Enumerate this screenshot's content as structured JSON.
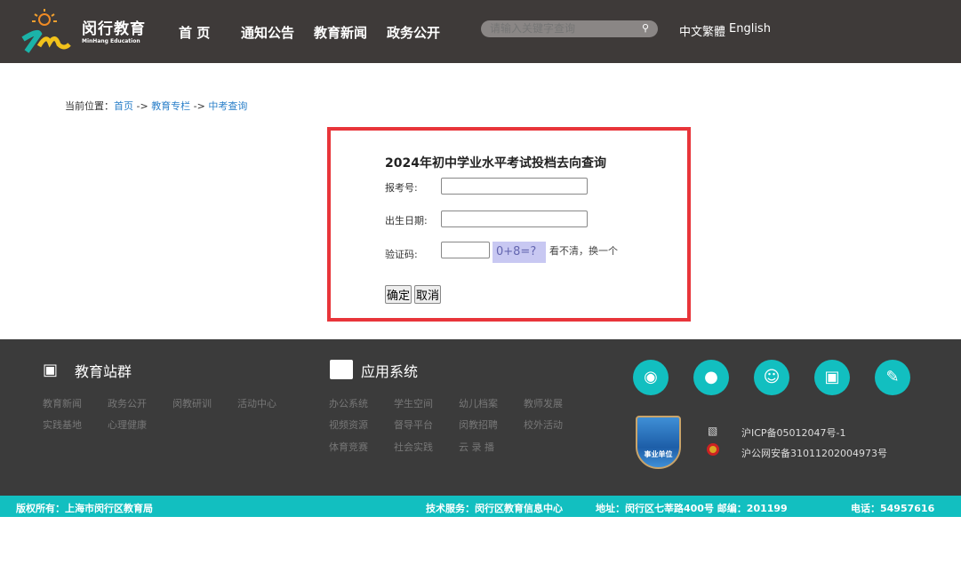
{
  "header": {
    "brand_cn": "闵行教育",
    "brand_en": "MinHang Education",
    "nav": [
      "首 页",
      "通知公告",
      "教育新闻",
      "政务公开"
    ],
    "search_placeholder": "请输入关键字查询",
    "search_icon": "search-icon",
    "lang_cn": "中文繁體",
    "lang_en": "English"
  },
  "breadcrumb": {
    "prefix": "当前位置：",
    "items": [
      "首页",
      "教育专栏",
      "中考查询"
    ],
    "sep": " -> "
  },
  "form": {
    "title": "2024年初中学业水平考试投档去向查询",
    "exam_no_label": "报考号:",
    "birth_label": "出生日期:",
    "captcha_label": "验证码:",
    "captcha_text": "0+8=?",
    "refresh_label": "看不清，换一个",
    "submit": "确定",
    "cancel": "取消",
    "exam_no": "",
    "birth": "",
    "captcha": ""
  },
  "footer": {
    "group1": {
      "title": "教育站群",
      "links": [
        "教育新闻",
        "政务公开",
        "闵教研训",
        "活动中心",
        "实践基地",
        "心理健康"
      ]
    },
    "group2": {
      "title": "应用系统",
      "links": [
        "办公系统",
        "学生空间",
        "幼儿档案",
        "教师发展",
        "视频资源",
        "督导平台",
        "闵教招聘",
        "校外活动",
        "体育竞赛",
        "社会实践",
        "云 录 播"
      ]
    },
    "social_icons": [
      "weibo-icon",
      "wechat-icon",
      "graduate-icon",
      "app-icon",
      "pencil-ruler-icon"
    ],
    "badge": "事业单位",
    "icp": "沪ICP备05012047号-1",
    "police": "沪公网安备31011202004973号"
  },
  "bottom": {
    "copyright": "版权所有：上海市闵行区教育局",
    "tech": "技术服务：闵行区教育信息中心",
    "address": "地址：闵行区七莘路400号 邮编：201199",
    "phone": "电话：54957616"
  },
  "colors": {
    "header": "#3e3a39",
    "footer": "#3b3b3b",
    "accent": "#12bfc0",
    "box_border": "#e8353a"
  }
}
